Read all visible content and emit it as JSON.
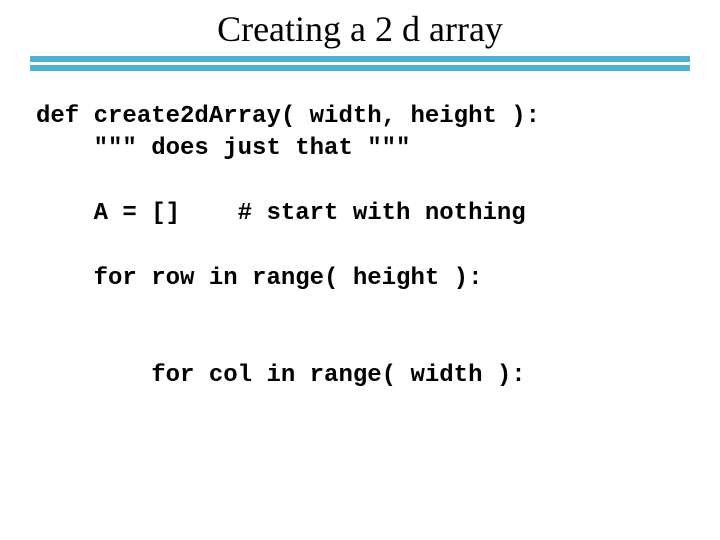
{
  "title": "Creating a 2 d array",
  "code": {
    "l1": "def create2dArray( width, height ):",
    "l2": "    \"\"\" does just that \"\"\"",
    "l3": "",
    "l4": "    A = []    # start with nothing",
    "l5": "",
    "l6": "    for row in range( height ):",
    "l7": "",
    "l8": "",
    "l9": "        for col in range( width ):"
  }
}
